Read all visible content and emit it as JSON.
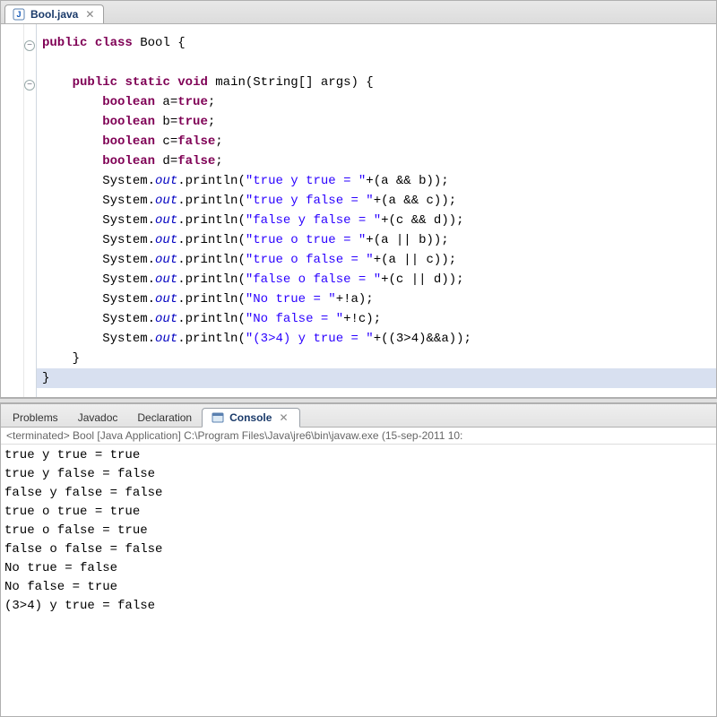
{
  "editor": {
    "tab": {
      "label": "Bool.java",
      "close_glyph": "✕"
    }
  },
  "code": {
    "class_decl": {
      "kw1": "public",
      "kw2": "class",
      "name": "Bool",
      "open": "{"
    },
    "main_decl": {
      "kw1": "public",
      "kw2": "static",
      "kw3": "void",
      "name": "main",
      "params_open": "(",
      "arg_type": "String[]",
      "arg_name": "args",
      "params_close": ")",
      "open": "{"
    },
    "decls": [
      {
        "kw": "boolean",
        "rest": " a=",
        "lit": "true",
        "semi": ";"
      },
      {
        "kw": "boolean",
        "rest": " b=",
        "lit": "true",
        "semi": ";"
      },
      {
        "kw": "boolean",
        "rest": " c=",
        "lit": "false",
        "semi": ";"
      },
      {
        "kw": "boolean",
        "rest": " d=",
        "lit": "false",
        "semi": ";"
      }
    ],
    "prints": [
      {
        "pre": "System.",
        "out": "out",
        "mid": ".println(",
        "str": "\"true y true = \"",
        "post": "+(a && b));"
      },
      {
        "pre": "System.",
        "out": "out",
        "mid": ".println(",
        "str": "\"true y false = \"",
        "post": "+(a && c));"
      },
      {
        "pre": "System.",
        "out": "out",
        "mid": ".println(",
        "str": "\"false y false = \"",
        "post": "+(c && d));"
      },
      {
        "pre": "System.",
        "out": "out",
        "mid": ".println(",
        "str": "\"true o true = \"",
        "post": "+(a || b));"
      },
      {
        "pre": "System.",
        "out": "out",
        "mid": ".println(",
        "str": "\"true o false = \"",
        "post": "+(a || c));"
      },
      {
        "pre": "System.",
        "out": "out",
        "mid": ".println(",
        "str": "\"false o false = \"",
        "post": "+(c || d));"
      },
      {
        "pre": "System.",
        "out": "out",
        "mid": ".println(",
        "str": "\"No true = \"",
        "post": "+!a);"
      },
      {
        "pre": "System.",
        "out": "out",
        "mid": ".println(",
        "str": "\"No false = \"",
        "post": "+!c);"
      },
      {
        "pre": "System.",
        "out": "out",
        "mid": ".println(",
        "str": "\"(3>4) y true = \"",
        "post": "+((3>4)&&a));"
      }
    ],
    "close_brace": "}"
  },
  "bottom": {
    "tabs": {
      "problems": "Problems",
      "javadoc": "Javadoc",
      "declaration": "Declaration",
      "console": "Console",
      "close_glyph": "✕"
    },
    "status": "<terminated> Bool [Java Application] C:\\Program Files\\Java\\jre6\\bin\\javaw.exe (15-sep-2011 10:",
    "output": [
      "true y true = true",
      "true y false = false",
      "false y false = false",
      "true o true = true",
      "true o false = true",
      "false o false = false",
      "No true = false",
      "No false = true",
      "(3>4) y true = false"
    ]
  }
}
